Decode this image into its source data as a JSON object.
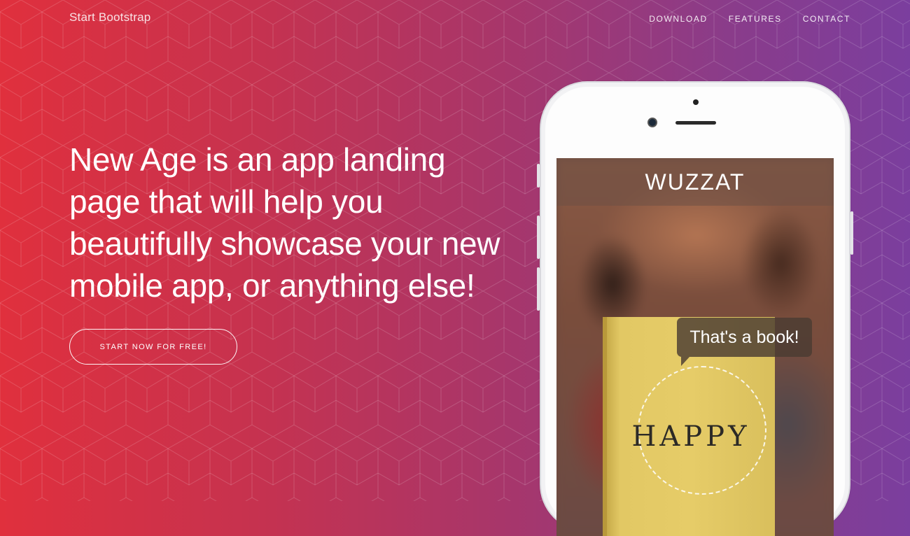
{
  "nav": {
    "brand": "Start Bootstrap",
    "links": [
      "DOWNLOAD",
      "FEATURES",
      "CONTACT"
    ]
  },
  "hero": {
    "headline": "New Age is an app landing page that will help you beautifully showcase your new mobile app, or anything else!",
    "cta_label": "START NOW FOR FREE!"
  },
  "device": {
    "app_title": "WUZZAT",
    "bubble_text": "That's a book!",
    "book_title": "HAPPY"
  },
  "colors": {
    "gradient_start": "#e0303d",
    "gradient_end": "#7b3e9e"
  }
}
